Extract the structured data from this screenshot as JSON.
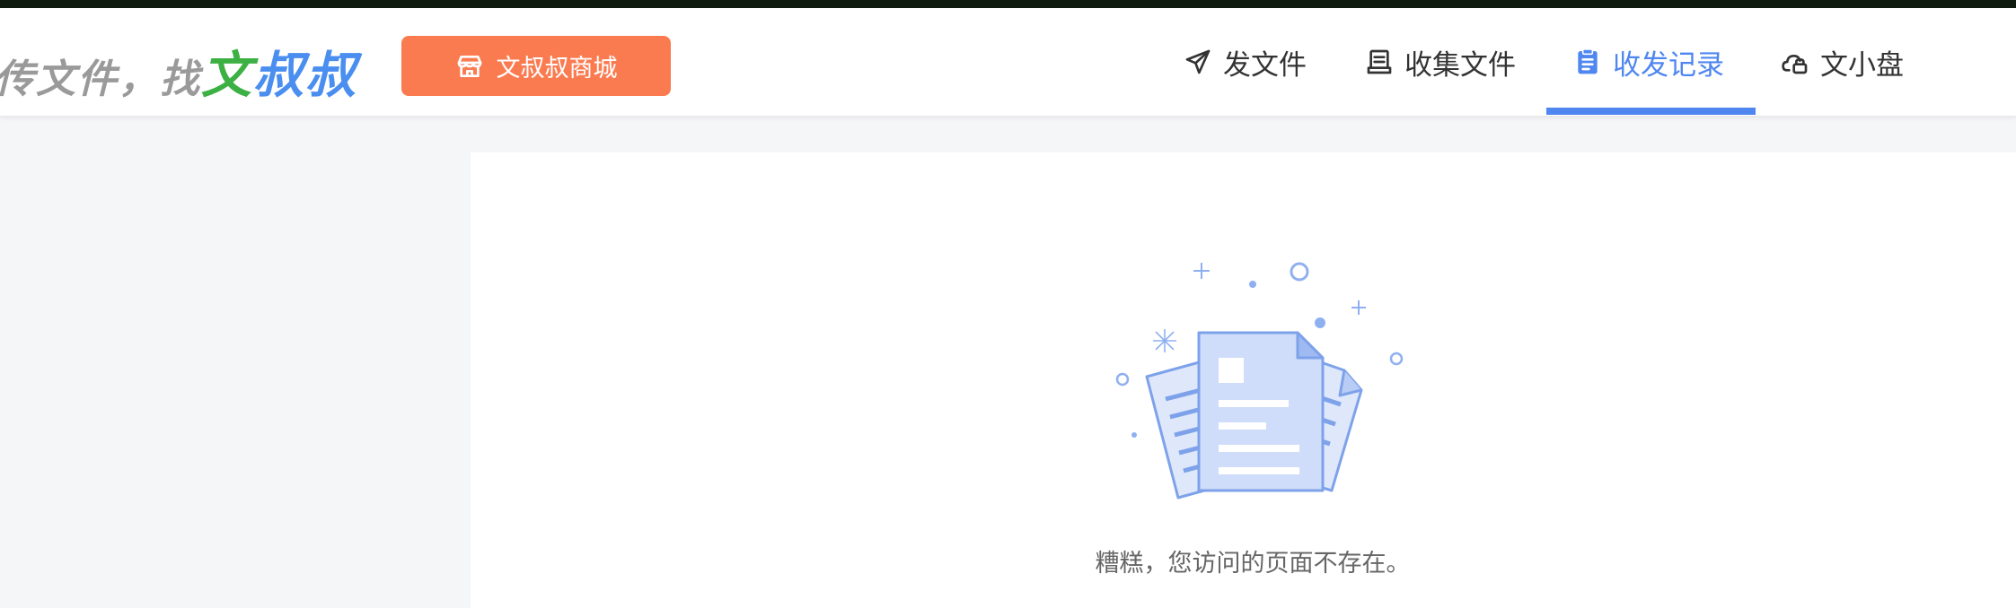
{
  "header": {
    "slogan_prefix": "传文件，找",
    "brand_part1": "文",
    "brand_part2": "叔叔",
    "mall_button_label": "文叔叔商城"
  },
  "nav": {
    "items": [
      {
        "label": "发文件",
        "icon": "paper-plane-icon"
      },
      {
        "label": "收集文件",
        "icon": "inbox-icon"
      },
      {
        "label": "收发记录",
        "icon": "clipboard-icon",
        "active": true
      },
      {
        "label": "文小盘",
        "icon": "cloud-lock-icon"
      }
    ]
  },
  "main": {
    "error_message": "糟糕，您访问的页面不存在。"
  },
  "colors": {
    "accent": "#4f86f0",
    "mall_button": "#fb7b51",
    "brand_green": "#3cb043",
    "brand_blue": "#4a8ef0"
  }
}
